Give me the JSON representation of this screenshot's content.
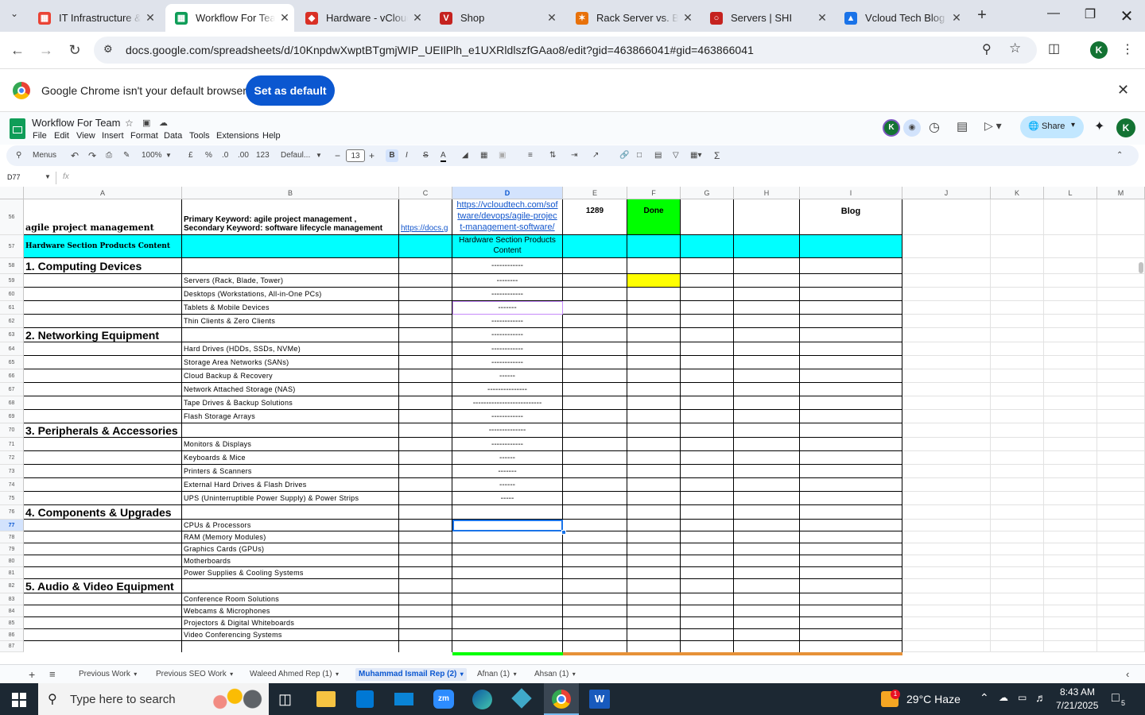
{
  "browser": {
    "tabs": [
      {
        "title": "IT Infrastructure &",
        "icon": "sheets-red-icon",
        "active": false
      },
      {
        "title": "Workflow For Team",
        "icon": "sheets-icon",
        "active": true
      },
      {
        "title": "Hardware - vCloud",
        "icon": "vcloud-red-icon",
        "active": false
      },
      {
        "title": "Shop",
        "icon": "shop-v-icon",
        "active": false
      },
      {
        "title": "Rack Server vs. Bla",
        "icon": "rack-server-icon",
        "active": false
      },
      {
        "title": "Servers | SHI",
        "icon": "shi-icon",
        "active": false
      },
      {
        "title": "Vcloud Tech Blog",
        "icon": "drive-icon",
        "active": false
      }
    ],
    "new_tab": "+",
    "url": "docs.google.com/spreadsheets/d/10KnpdwXwptBTgmjWIP_UEIlPlh_e1UXRldlszfGAao8/edit?gid=463866041#gid=463866041",
    "profile_initial": "K"
  },
  "infobar": {
    "message": "Google Chrome isn't your default browser",
    "button": "Set as default"
  },
  "sheets": {
    "doc_title": "Workflow For Team",
    "menus": [
      "File",
      "Edit",
      "View",
      "Insert",
      "Format",
      "Data",
      "Tools",
      "Extensions",
      "Help"
    ],
    "share_label": "Share",
    "avatar_initial": "K",
    "toolbar": {
      "menus_label": "Menus",
      "zoom": "100%",
      "currency": "£",
      "percent": "%",
      "dec_less": ".0",
      "dec_more": ".00",
      "number_format": "123",
      "font_family": "Defaul...",
      "font_size": "13",
      "bold": "B",
      "italic": "I",
      "strike": "S",
      "text_color": "A",
      "sum": "Σ"
    },
    "name_box": "D77",
    "fx": "fx",
    "columns": [
      "A",
      "B",
      "C",
      "D",
      "E",
      "F",
      "G",
      "H",
      "I",
      "J",
      "K",
      "L",
      "M"
    ],
    "rows": [
      {
        "num": "56",
        "a": "agile project management",
        "b1": "Primary Keyword:  agile project management ,",
        "b2": "Secondary Keyword:  software lifecycle management",
        "c": "https://docs.g",
        "d": "https://vcloudtech.com/software/devops/agile-project-management-software/",
        "d_lines": [
          "https://vcloudtech.com/sof",
          "tware/devops/agile-projec",
          "t-management-software/"
        ],
        "e": "1289",
        "f": "Done",
        "i": "Blog"
      },
      {
        "num": "57",
        "a": "Hardware Section Products Content",
        "d_lines": [
          "Hardware Section Products",
          "Content"
        ]
      },
      {
        "num": "58",
        "a": "1. Computing Devices",
        "d": "------------"
      },
      {
        "num": "59",
        "b": "Servers (Rack, Blade, Tower)",
        "d": "--------"
      },
      {
        "num": "60",
        "b": "Desktops (Workstations, All-in-One PCs)",
        "d": "------------"
      },
      {
        "num": "61",
        "b": "Tablets & Mobile Devices",
        "d": "-------"
      },
      {
        "num": "62",
        "b": "Thin Clients & Zero Clients",
        "d": "------------"
      },
      {
        "num": "63",
        "a": "2. Networking Equipment",
        "d": "------------"
      },
      {
        "num": "64",
        "b": "Hard Drives (HDDs, SSDs, NVMe)",
        "d": "------------"
      },
      {
        "num": "65",
        "b": "Storage Area Networks (SANs)",
        "d": "------------"
      },
      {
        "num": "66",
        "b": "Cloud Backup & Recovery",
        "d": "------"
      },
      {
        "num": "67",
        "b": "Network Attached Storage (NAS)",
        "d": "---------------"
      },
      {
        "num": "68",
        "b": "Tape Drives & Backup Solutions",
        "d": "--------------------------"
      },
      {
        "num": "69",
        "b": "Flash Storage Arrays",
        "d": "------------"
      },
      {
        "num": "70",
        "a": "3. Peripherals & Accessories",
        "d": "--------------"
      },
      {
        "num": "71",
        "b": "Monitors & Displays",
        "d": "------------"
      },
      {
        "num": "72",
        "b": "Keyboards & Mice",
        "d": "------"
      },
      {
        "num": "73",
        "b": "Printers & Scanners",
        "d": "-------"
      },
      {
        "num": "74",
        "b": "External Hard Drives & Flash Drives",
        "d": "------"
      },
      {
        "num": "75",
        "b": "UPS (Uninterruptible Power Supply) & Power Strips",
        "d": "-----"
      },
      {
        "num": "76",
        "a": "4. Components & Upgrades"
      },
      {
        "num": "77",
        "b": "CPUs & Processors"
      },
      {
        "num": "78",
        "b": "RAM (Memory Modules)"
      },
      {
        "num": "79",
        "b": "Graphics Cards (GPUs)"
      },
      {
        "num": "80",
        "b": "Motherboards"
      },
      {
        "num": "81",
        "b": "Power Supplies & Cooling Systems"
      },
      {
        "num": "82",
        "a": "5. Audio & Video Equipment"
      },
      {
        "num": "83",
        "b": "Conference Room Solutions"
      },
      {
        "num": "84",
        "b": "Webcams & Microphones"
      },
      {
        "num": "85",
        "b": "Projectors & Digital Whiteboards"
      },
      {
        "num": "86",
        "b": "Video Conferencing Systems"
      },
      {
        "num": "87"
      }
    ],
    "sheet_tabs": [
      {
        "label": "Previous Work",
        "active": false
      },
      {
        "label": "Previous SEO Work",
        "active": false
      },
      {
        "label": "Waleed Ahmed Rep (1)",
        "active": false
      },
      {
        "label": "Muhammad Ismail Rep (2)",
        "active": true
      },
      {
        "label": "Afnan (1)",
        "active": false
      },
      {
        "label": "Ahsan (1)",
        "active": false
      }
    ],
    "colors": {
      "cyan": "#00ffff",
      "green": "#00ff00",
      "yellow": "#ffff00",
      "link": "#1155cc",
      "selected": "#1a73e8"
    }
  },
  "taskbar": {
    "search_placeholder": "Type here to search",
    "weather": "29°C  Haze",
    "weather_badge": "1",
    "time": "8:43 AM",
    "date": "7/21/2025",
    "notif_count": "5"
  }
}
